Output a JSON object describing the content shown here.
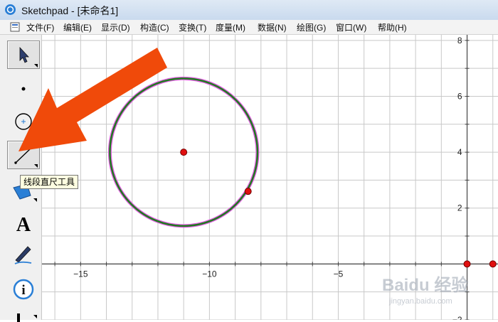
{
  "window": {
    "title": "Sketchpad  - [未命名1]"
  },
  "menu": [
    "文件(F)",
    "编辑(E)",
    "显示(D)",
    "构造(C)",
    "变换(T)",
    "度量(M)",
    "数据(N)",
    "绘图(G)",
    "窗口(W)",
    "帮助(H)"
  ],
  "toolbox": {
    "tools": [
      "arrow-select-tool",
      "point-tool",
      "compass-tool",
      "straightedge-tool",
      "polygon-tool",
      "text-tool",
      "marker-tool",
      "information-tool",
      "custom-tool"
    ],
    "selected": "arrow-select-tool",
    "tooltip": "线段直尺工具"
  },
  "graph": {
    "x_labels": [
      "−15",
      "−10",
      "−5"
    ],
    "y_labels": [
      "8",
      "6",
      "4",
      "2",
      "−2"
    ],
    "x_range": [
      -16.5,
      1.2
    ],
    "y_range": [
      -2.0,
      8.2
    ],
    "grid": true,
    "circle": {
      "center": [
        -11,
        4
      ],
      "edge_point": [
        -8.5,
        2.6
      ]
    },
    "axis_points": [
      [
        0,
        0
      ],
      [
        1,
        0
      ]
    ],
    "colors": {
      "circle_outer": "#e060e0",
      "circle_inner": "#1e7a1e",
      "point": "#e01010",
      "grid": "#c8c8c8",
      "axis": "#444444",
      "annotation_arrow": "#f04a0a"
    }
  },
  "watermark": {
    "text": "Baidu 经验",
    "url": "jingyan.baidu.com"
  }
}
